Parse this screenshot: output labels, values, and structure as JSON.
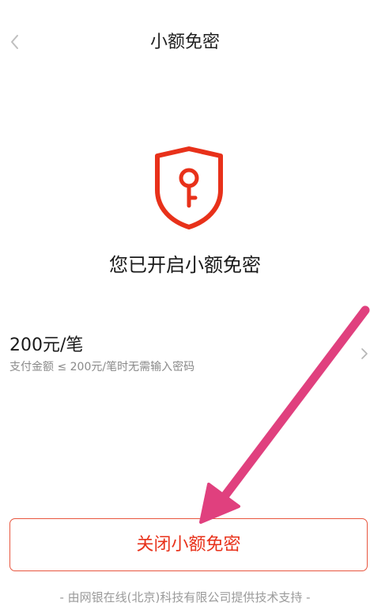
{
  "header": {
    "title": "小额免密"
  },
  "status": {
    "title": "您已开启小额免密"
  },
  "limit": {
    "amount": "200元/笔",
    "description": "支付金额 ≤ 200元/笔时无需输入密码"
  },
  "actions": {
    "close_label": "关闭小额免密"
  },
  "footer": {
    "text": "- 由网银在线(北京)科技有限公司提供技术支持 -"
  },
  "icons": {
    "back": "chevron-left-icon",
    "shield": "shield-key-icon",
    "row_arrow": "chevron-right-icon"
  },
  "colors": {
    "accent": "#e8311a",
    "annotation_arrow": "#e0407e"
  }
}
